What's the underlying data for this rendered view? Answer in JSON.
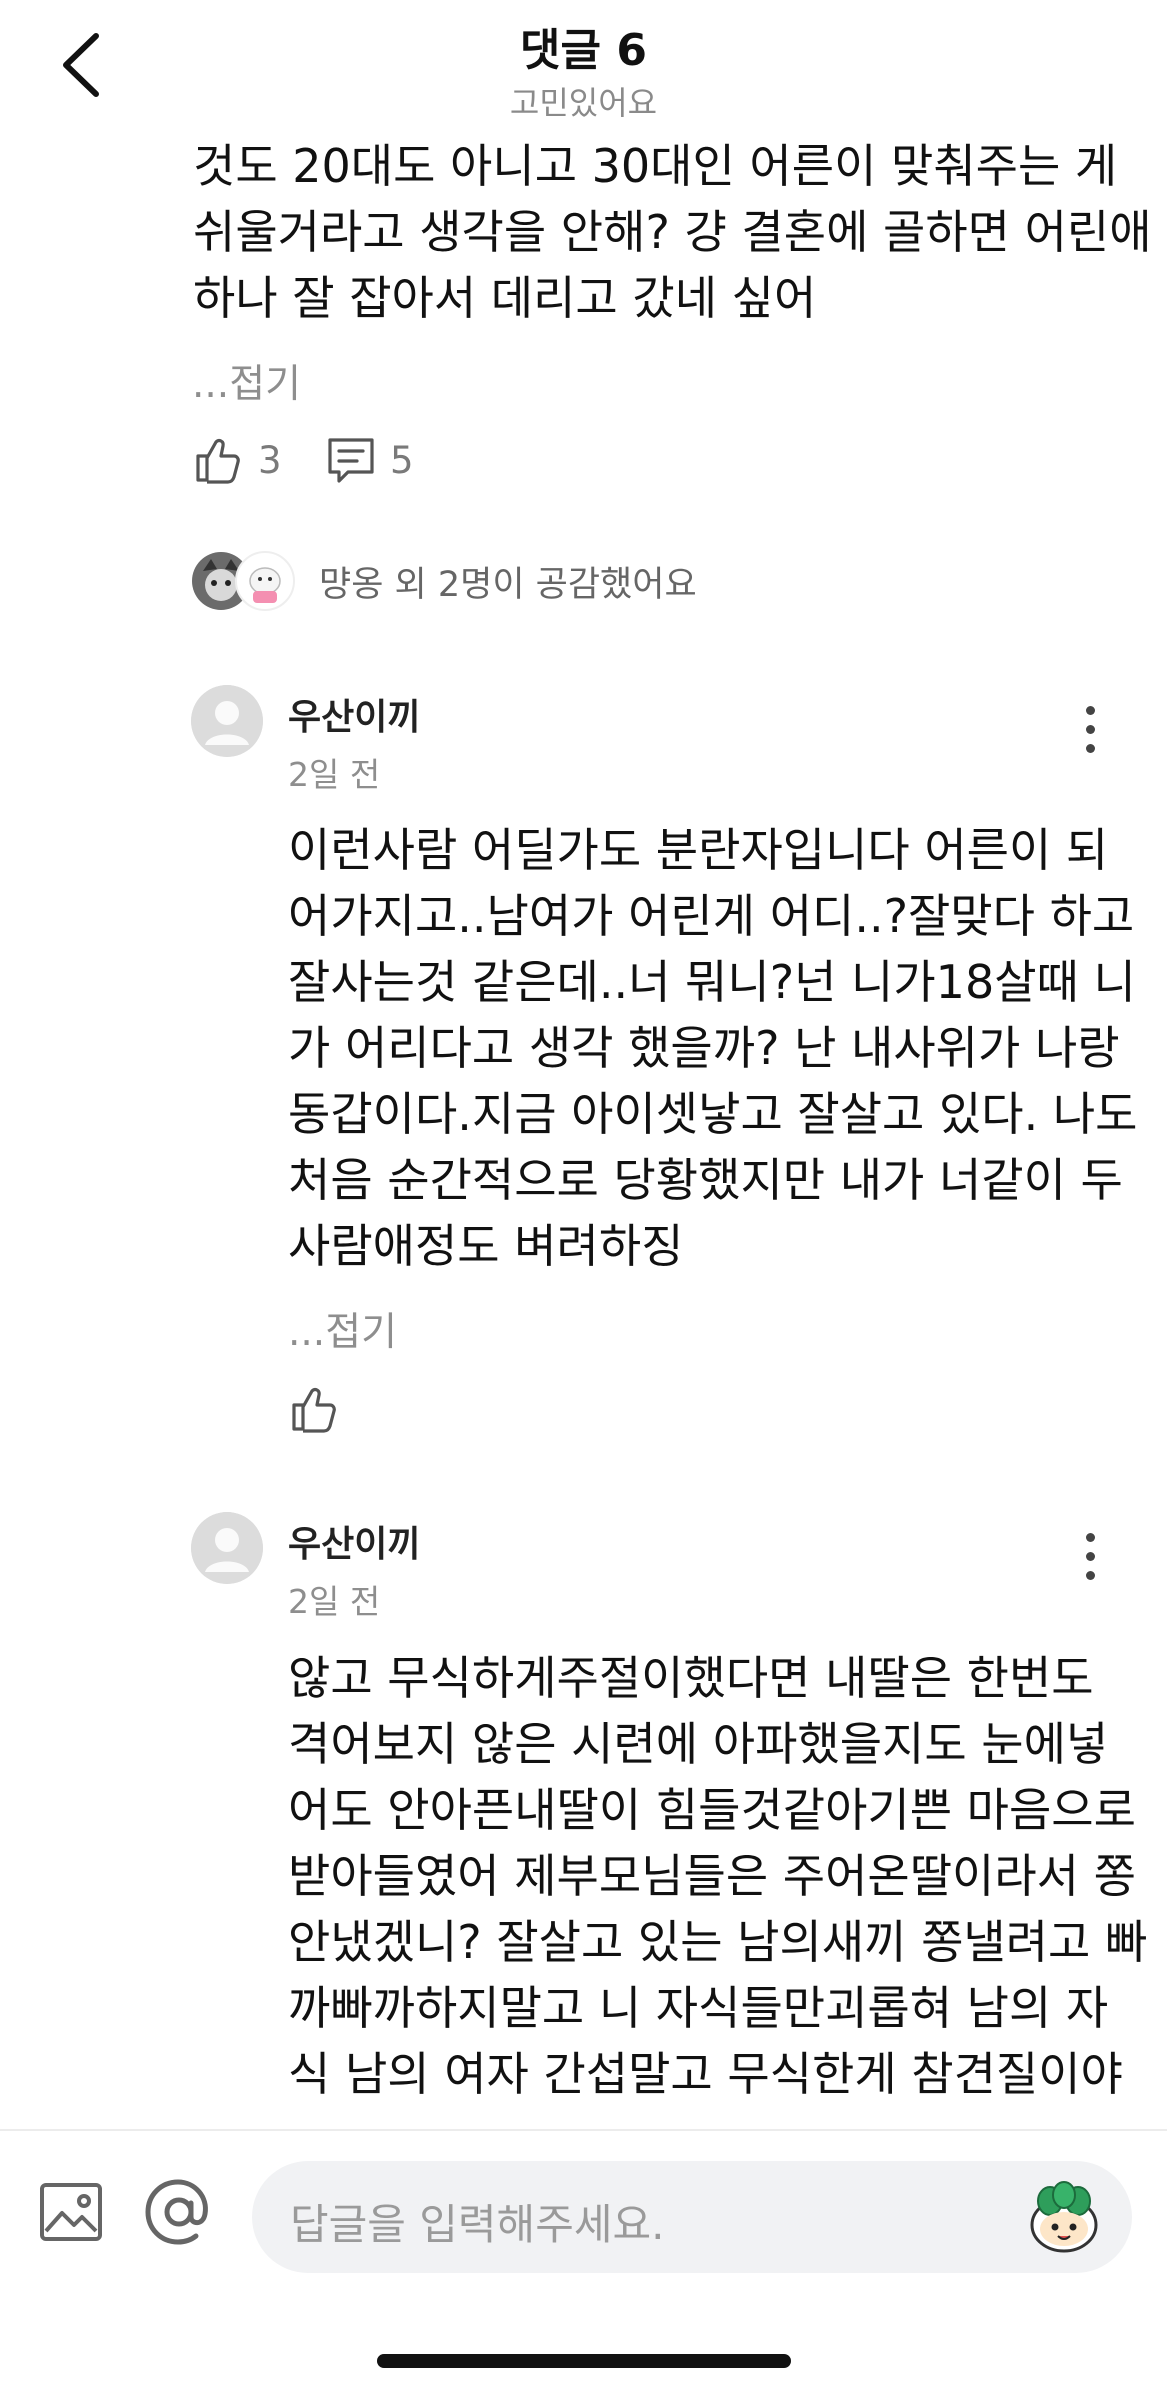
{
  "header": {
    "title": "댓글 6",
    "subtitle": "고민있어요"
  },
  "parent_comment": {
    "text_lines": [
      "것도 20대도 아니고 30대인 어른이 맞춰주는 게",
      "쉬울거라고 생각을 안해? 걍 결혼에 골하면 어린애",
      "하나 잘 잡아서 데리고 갔네 싶어"
    ],
    "fold_label": "...접기",
    "like_count": "3",
    "reply_count": "5",
    "sympathy_text": "먕옹 외 2명이 공감했어요"
  },
  "replies": [
    {
      "author": "우산이끼",
      "time": "2일 전",
      "text_lines": [
        "이런사람 어딜가도 분란자입니다 어른이 되",
        "어가지고..남여가 어린게 어디..?잘맞다 하고",
        "잘사는것 같은데..너 뭐니?넌 니가18살때 니",
        "가 어리다고 생각 했을까? 난 내사위가 나랑",
        "동갑이다.지금 아이셋낳고 잘살고 있다. 나도",
        "처음 순간적으로 당황했지만 내가 너같이 두",
        "사람애정도 벼려하징"
      ],
      "fold_label": "...접기"
    },
    {
      "author": "우산이끼",
      "time": "2일 전",
      "text_lines": [
        "않고 무식하게주절이했다면 내딸은 한번도",
        "격어보지 않은 시련에 아파했을지도 눈에넣",
        "어도 안아픈내딸이 힘들것같아기쁜 마음으로",
        "받아들였어 제부모님들은 주어온딸이라서 쫑",
        "안냈겠니? 잘살고 있는 남의새끼 쫑낼려고 빠",
        "까빠까하지말고 니 자식들만괴롭혀 남의 자",
        "식 남의 여자 간섭말고 무식한게 참견질이야"
      ]
    }
  ],
  "composer": {
    "placeholder": "답글을 입력해주세요."
  },
  "icons": {
    "back": "chevron-left-icon",
    "like": "thumbs-up-icon",
    "reply": "comment-icon",
    "more": "kebab-menu-icon",
    "image": "image-icon",
    "mention": "at-sign-icon",
    "sticker": "sticker-icon"
  }
}
